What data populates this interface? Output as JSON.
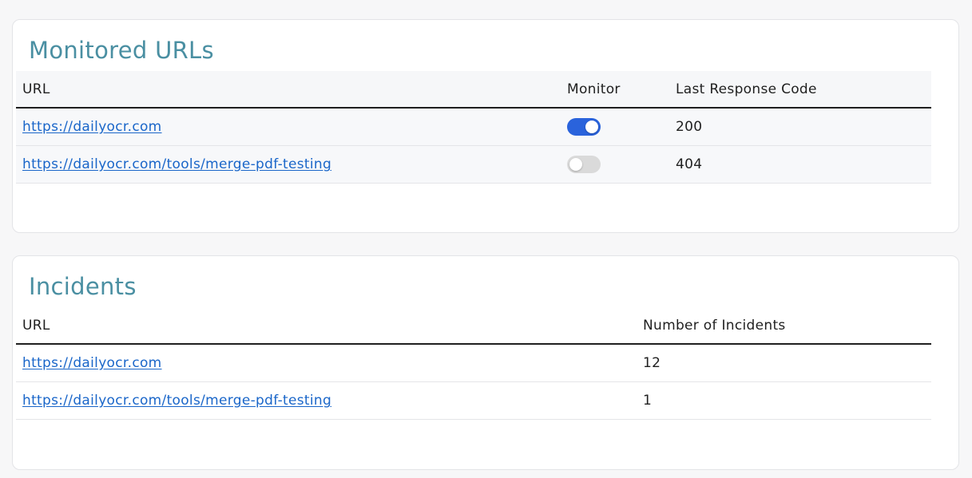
{
  "monitored": {
    "title": "Monitored URLs",
    "columns": {
      "url": "URL",
      "monitor": "Monitor",
      "code": "Last Response Code"
    },
    "rows": [
      {
        "url": "https://dailyocr.com",
        "monitor": true,
        "code": "200"
      },
      {
        "url": "https://dailyocr.com/tools/merge-pdf-testing",
        "monitor": false,
        "code": "404"
      }
    ]
  },
  "incidents": {
    "title": "Incidents",
    "columns": {
      "url": "URL",
      "count": "Number of Incidents"
    },
    "rows": [
      {
        "url": "https://dailyocr.com",
        "count": "12"
      },
      {
        "url": "https://dailyocr.com/tools/merge-pdf-testing",
        "count": "1"
      }
    ]
  },
  "colors": {
    "title": "#4a8fa2",
    "link": "#1a66c9",
    "toggle_on": "#2a63dc",
    "toggle_off": "#dadada"
  }
}
